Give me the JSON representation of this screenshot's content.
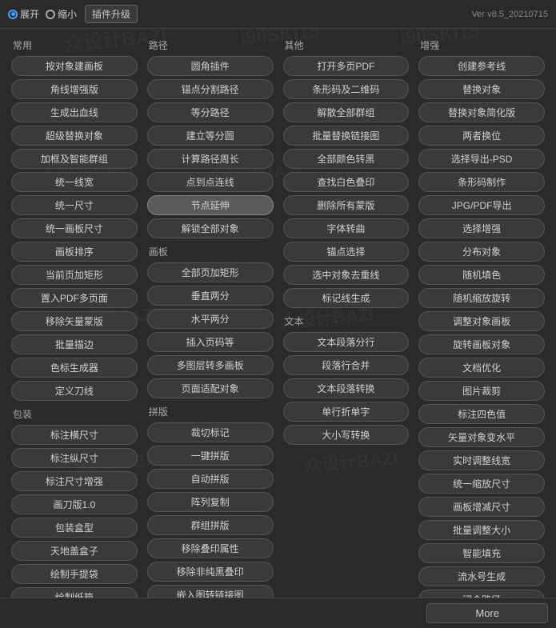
{
  "topBar": {
    "radio1": "展开",
    "radio2": "缩小",
    "pluginUpgrade": "插件升级",
    "version": "Ver v8.5_20210715"
  },
  "sections": [
    {
      "id": "common",
      "title": "常用",
      "buttons": [
        "按对象建画板",
        "角线增强版",
        "生成出血线",
        "超级替换对象",
        "加框及智能群组",
        "统一线宽",
        "统一尺寸",
        "统一画板尺寸",
        "画板排序",
        "当前页加矩形",
        "置入PDF多页面",
        "移除矢量蒙版",
        "批量描边",
        "色标生成器",
        "定义刀线"
      ]
    },
    {
      "id": "path",
      "title": "路径",
      "buttons": [
        "圆角插件",
        "锚点分割路径",
        "等分路径",
        "建立等分圆",
        "计算路径周长",
        "点到点连线",
        "节点延伸",
        "解锁全部对象"
      ]
    },
    {
      "id": "canvas",
      "title": "画板",
      "buttons": [
        "全部页加矩形",
        "垂直两分",
        "水平两分",
        "插入页码等",
        "多图层转多画板",
        "页面适配对象"
      ]
    },
    {
      "id": "typesetting",
      "title": "拼版",
      "buttons": [
        "裁切标记",
        "一键拼版",
        "自动拼版",
        "阵列复制",
        "群组拼版",
        "移除叠印属性",
        "移除非纯黑叠印",
        "嵌入图转链接图"
      ]
    },
    {
      "id": "other",
      "title": "其他",
      "buttons": [
        "打开多页PDF",
        "条形码及二维码",
        "解散全部群组",
        "批量替换链接图",
        "全部颜色转黑",
        "查找白色叠印",
        "删除所有蒙版",
        "字体转曲",
        "锚点选择",
        "选中对象去重线",
        "标记线生成"
      ]
    },
    {
      "id": "text",
      "title": "文本",
      "buttons": [
        "文本段落分行",
        "段落行合并",
        "文本段落转换",
        "单行折单字",
        "大小写转换"
      ]
    },
    {
      "id": "packaging",
      "title": "包装",
      "buttons": [
        "标注横尺寸",
        "标注纵尺寸",
        "标注尺寸增强",
        "画刀版1.0",
        "包装盒型",
        "天地盖盒子",
        "绘制手提袋",
        "绘制纸箱"
      ]
    },
    {
      "id": "enhance",
      "title": "增强",
      "buttons": [
        "创建参考线",
        "替换对象",
        "替换对象简化版",
        "两者换位",
        "选择导出-PSD",
        "条形码制作",
        "JPG/PDF导出",
        "选择增强",
        "分布对象",
        "随机填色",
        "随机缩放旋转",
        "调整对象画板",
        "旋转画板对象",
        "文档优化",
        "图片裁剪",
        "标注四色值",
        "矢量对象变水平",
        "实时调整线宽",
        "统一缩放尺寸",
        "画板增减尺寸",
        "批量调整大小",
        "智能填充",
        "流水号生成",
        "闭合路径"
      ]
    }
  ],
  "bottomBar": {
    "moreLabel": "More"
  }
}
